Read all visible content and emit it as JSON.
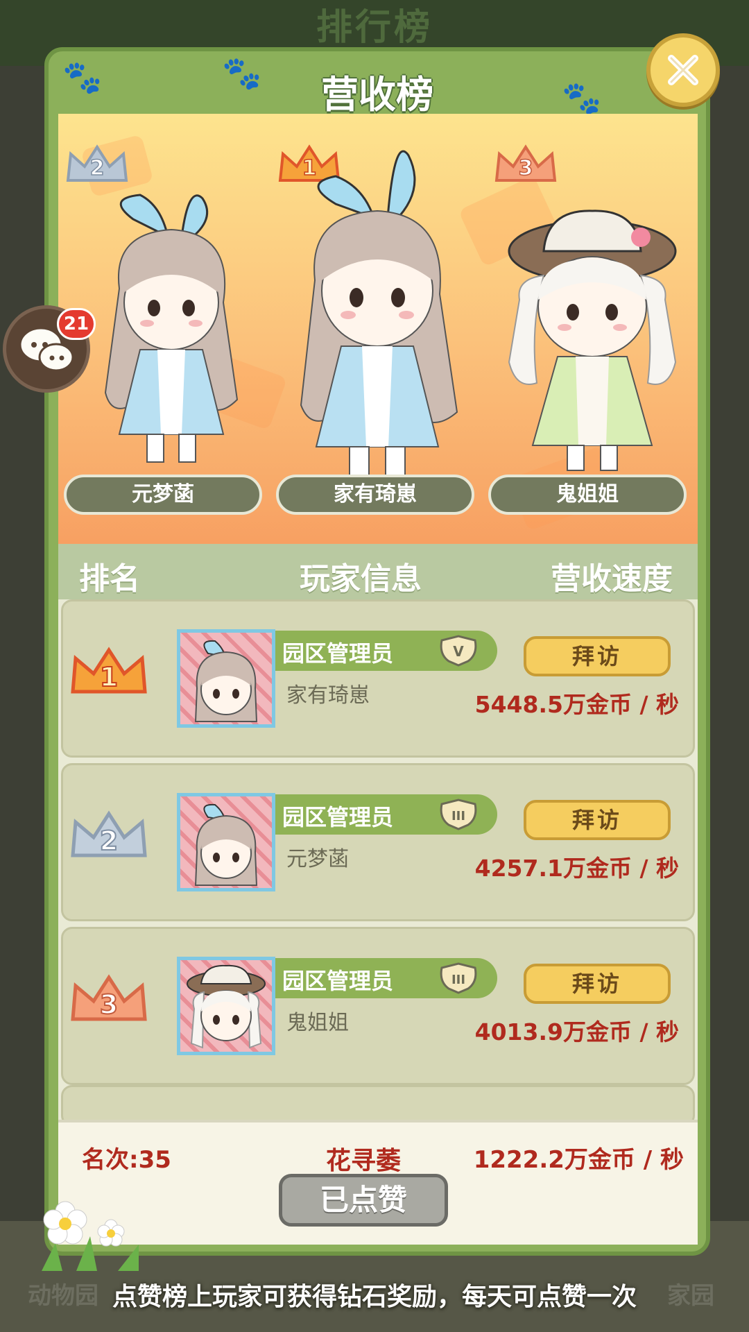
{
  "background": {
    "title": "排行榜",
    "nav": [
      "动物园",
      "家园"
    ],
    "hint": "点赞榜上玩家可获得钻石奖励，每天可点赞一次"
  },
  "modal": {
    "title": "营收榜"
  },
  "chat": {
    "unread": "21"
  },
  "podium": [
    {
      "rank": "2",
      "name": "元梦菡",
      "crown_color": "#aebccd"
    },
    {
      "rank": "1",
      "name": "家有琦崽",
      "crown_color": "#f07a2a"
    },
    {
      "rank": "3",
      "name": "鬼姐姐",
      "crown_color": "#ef8b63"
    }
  ],
  "list": {
    "headers": {
      "rank": "排名",
      "player": "玩家信息",
      "speed": "营收速度"
    },
    "rows": [
      {
        "rank": "1",
        "title": "园区管理员",
        "badge": "V",
        "name": "家有琦崽",
        "visit": "拜访",
        "speed": "5448.5万金币 / 秒"
      },
      {
        "rank": "2",
        "title": "园区管理员",
        "badge": "III",
        "name": "元梦菡",
        "visit": "拜访",
        "speed": "4257.1万金币 / 秒"
      },
      {
        "rank": "3",
        "title": "园区管理员",
        "badge": "III",
        "name": "鬼姐姐",
        "visit": "拜访",
        "speed": "4013.9万金币 / 秒"
      }
    ]
  },
  "self": {
    "rank": "名次:35",
    "name": "花寻萎",
    "speed": "1222.2万金币 / 秒",
    "liked": "已点赞"
  },
  "colors": {
    "frame_green": "#8cb05a",
    "speed_red": "#b02a1e",
    "visit_yellow": "#f5cd5f"
  }
}
